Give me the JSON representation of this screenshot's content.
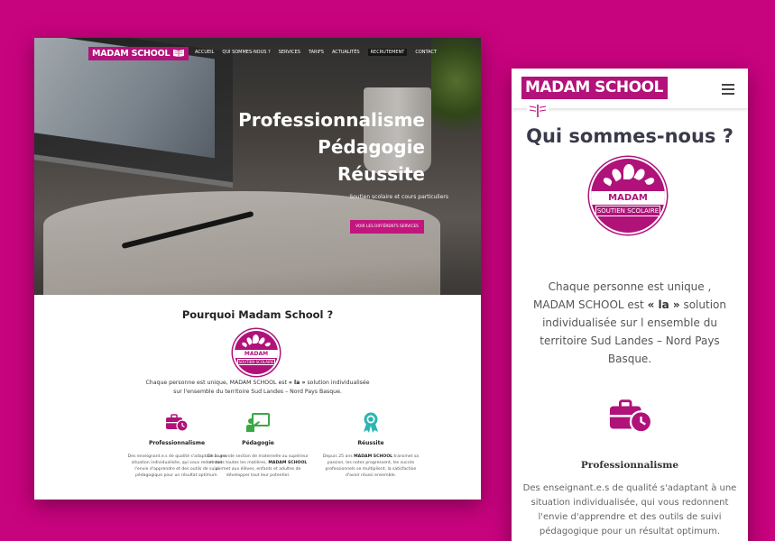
{
  "colors": {
    "brand": "#c8037e",
    "brand_dark": "#b01279",
    "teal": "#2bb5b4",
    "green": "#3aa845"
  },
  "desktop": {
    "logo_text": "MADAM SCHOOL",
    "nav": [
      "ACCUEIL",
      "QUI SOMMES-NOUS ?",
      "SERVICES",
      "TARIFS",
      "ACTUALITÉS",
      "RECRUTEMENT",
      "CONTACT"
    ],
    "hero": {
      "line1": "Professionnalisme",
      "line2": "Pédagogie",
      "line3": "Réussite",
      "subtitle": "Soutien scolaire et cours particuliers",
      "button": "VOIR LES DIFFÉRENTS SERVICES"
    },
    "section_title": "Pourquoi Madam School ?",
    "badge": {
      "top": "MADAM SCHOOL",
      "bottom": "SOUTIEN SCOLAIRE"
    },
    "intro": {
      "part1": "Chaque personne est unique, MADAM SCHOOL est ",
      "bold": "« la »",
      "part2": " solution individualisée",
      "line2": "sur l'ensemble du territoire Sud Landes – Nord Pays Basque."
    },
    "features": [
      {
        "icon": "briefcase-clock-icon",
        "title": "Professionnalisme",
        "desc": "Des enseignant.e.s de qualité s'adaptant à une situation individualisée, qui vous redonnent l'envie d'apprendre et des outils de suivi pédagogique pour un résultat optimum."
      },
      {
        "icon": "teacher-board-icon",
        "title": "Pédagogie",
        "desc_part1": "De la grande section de maternelle au supérieur et dans toutes les matières, ",
        "desc_bold": "MADAM SCHOOL",
        "desc_part2": " permet aux élèves, enfants et adultes de développer tout leur potentiel."
      },
      {
        "icon": "award-ribbon-icon",
        "title": "Réussite",
        "desc_part1": "Depuis 25 ans ",
        "desc_bold": "MADAM SCHOOL",
        "desc_part2": " transmet sa passion, les notes progressent, les succès professionnels se multiplient, la satisfaction d'avoir réussi ensemble."
      }
    ]
  },
  "mobile": {
    "logo_text": "MADAM SCHOOL",
    "menu_icon": "hamburger-menu-icon",
    "title": "Qui sommes-nous ?",
    "badge": {
      "top": "MADAM SCHOOL",
      "bottom": "SOUTIEN SCOLAIRE"
    },
    "intro": {
      "part1": "Chaque personne est unique , MADAM SCHOOL est ",
      "bold": "« la »",
      "part2": " solution individualisée sur l ensemble du territoire  Sud Landes – Nord Pays Basque."
    },
    "feature_title": "Professionnalisme",
    "feature_desc": "Des enseignant.e.s de qualité s'adaptant à une situation individualisée, qui vous redonnent l'envie d'apprendre et des outils de suivi pédagogique pour un résultat optimum."
  }
}
